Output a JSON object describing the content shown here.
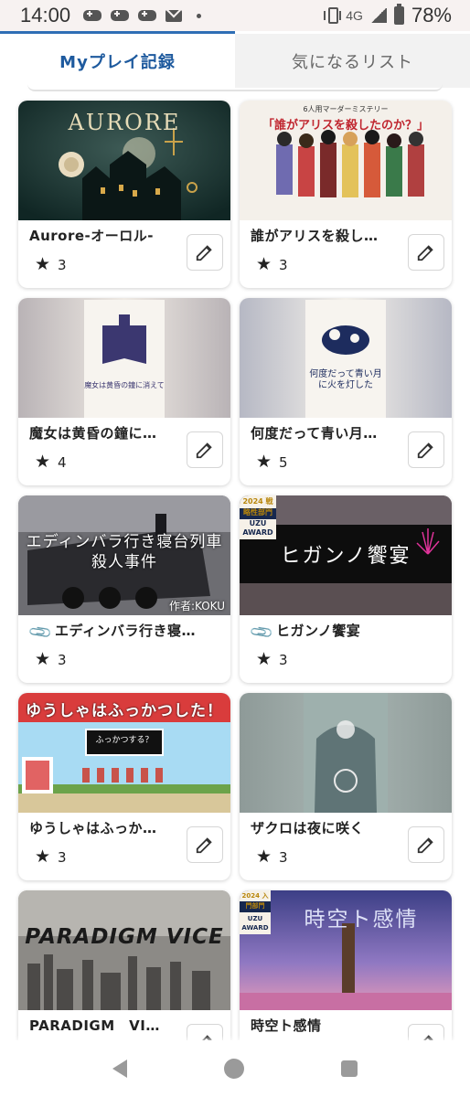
{
  "status_bar": {
    "time": "14:00",
    "network": "4G",
    "battery": "78%",
    "icons": [
      "gamepad-icon",
      "gamepad-icon",
      "gamepad-icon",
      "mail-icon",
      "dot-icon",
      "vibrate-icon",
      "signal-icon",
      "battery-icon"
    ]
  },
  "tabs": {
    "my_play": "Myプレイ記録",
    "wishlist": "気になるリスト"
  },
  "accent_color": "#2f6eb5",
  "cards": [
    {
      "title": "Aurore-オーロル-",
      "rating": "3",
      "thumb_text": "AURORE",
      "has_clip": false,
      "has_edit": true
    },
    {
      "title": "誰がアリスを殺し…",
      "rating": "3",
      "thumb_text": "「誰がアリスを殺したのか？」",
      "thumb_sub": "6人用マーダーミステリー",
      "has_clip": false,
      "has_edit": true
    },
    {
      "title": "魔女は黄昏の鐘に…",
      "rating": "4",
      "thumb_text": "魔女は黄昏の鐘に消えて",
      "has_clip": false,
      "has_edit": true
    },
    {
      "title": "何度だって青い月…",
      "rating": "5",
      "thumb_text": "何度だって青い月に火を灯した",
      "has_clip": false,
      "has_edit": true
    },
    {
      "title": "エディンバラ行き寝…",
      "rating": "3",
      "thumb_text": "エディンバラ行き寝台列車殺人事件",
      "thumb_sub": "作者:KOKU",
      "has_clip": true,
      "has_edit": false
    },
    {
      "title": "ヒガンノ饗宴",
      "rating": "3",
      "thumb_text": "ヒガンノ饗宴",
      "thumb_sub": "UZU AWARD",
      "badge": "2024 戦略性部門",
      "has_clip": true,
      "has_edit": false
    },
    {
      "title": "ゆうしゃはふっか…",
      "rating": "3",
      "thumb_text": "ゆうしゃはふっかつした！",
      "thumb_sub": "ふっかつする？",
      "has_clip": false,
      "has_edit": true
    },
    {
      "title": "ザクロは夜に咲く",
      "rating": "3",
      "thumb_text": "ザクロは夜に咲く",
      "has_clip": false,
      "has_edit": true
    },
    {
      "title": "PARADIGM　VI…",
      "rating": "",
      "thumb_text": "PARADIGM VICE",
      "has_clip": false,
      "has_edit": true
    },
    {
      "title": "時空ト感情",
      "rating": "",
      "thumb_text": "時空ト感情",
      "thumb_sub": "UZU AWARD",
      "badge": "2024 入門部門",
      "has_clip": false,
      "has_edit": true
    }
  ]
}
